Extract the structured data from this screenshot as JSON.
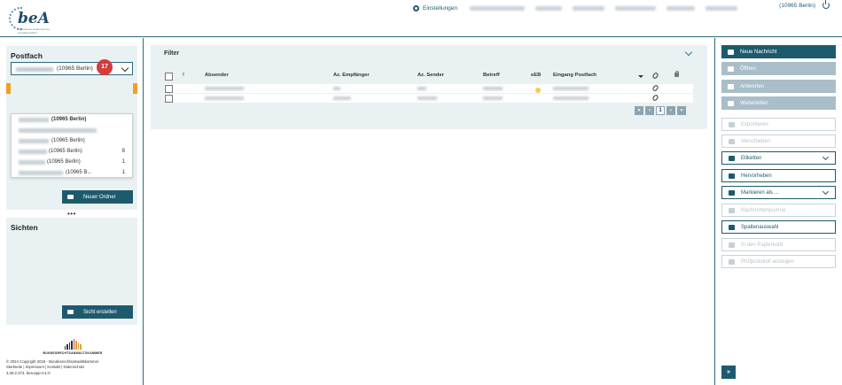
{
  "header": {
    "logo_text": "beA",
    "logo_sub": "Besonderes elektronisches Anwaltspostfach",
    "settings_label": "Einstellungen",
    "user_label": "(10965 Berlin)"
  },
  "left": {
    "postfach_title": "Postfach",
    "selected_mailbox": "(10965 Berlin)",
    "badge_count": "17",
    "dropdown_items": [
      {
        "label": "(10965 Berlin)",
        "count": "",
        "bold": true
      },
      {
        "label": "",
        "count": "",
        "bold": false
      },
      {
        "label": "(10965 Berlin)",
        "count": "",
        "bold": false
      },
      {
        "label": "(10965 Berlin)",
        "count": "8",
        "bold": false
      },
      {
        "label": "(10965 Berlin)",
        "count": "1",
        "bold": false
      },
      {
        "label": "(10965 B...",
        "count": "1",
        "bold": false
      }
    ],
    "new_folder_label": "Neuer Ordner",
    "sichten_title": "Sichten",
    "create_view_label": "Sicht erstellen",
    "brand_label": "BUNDESRECHTSANWALTSKAMMER",
    "footer_line1": "© 2024 Copyright 2018 - Bundesrechtsanwaltskammer",
    "footer_line2": "Startseite | Impressum | Kontakt | Datenschutz",
    "footer_line3": "3.28.2.373, bea-app-rc1-0"
  },
  "main": {
    "filter_title": "Filter",
    "columns": {
      "important": "!",
      "sender": "Absender",
      "az_recipient": "Az. Empfänger",
      "az_sender": "Az. Sender",
      "subject": "Betreff",
      "eeb": "eEB",
      "received": "Eingang Postfach"
    },
    "pager": {
      "first": "«",
      "prev": "‹",
      "page": "1",
      "next": "›",
      "last": "»"
    }
  },
  "right": {
    "new_message": "Neue Nachricht",
    "open": "Öffnen",
    "reply": "Antworten",
    "forward": "Weiterleiten",
    "export": "Exportieren",
    "move": "Verschieben",
    "labels": "Etiketten",
    "highlight": "Hervorheben",
    "mark_as": "Markieren als ...",
    "journal": "Nachrichtenjournal",
    "column_select": "Spaltenauswahl",
    "trash": "In den Papierkorb",
    "protocol": "Prüfprotokoll anzeigen",
    "expand": "»"
  }
}
